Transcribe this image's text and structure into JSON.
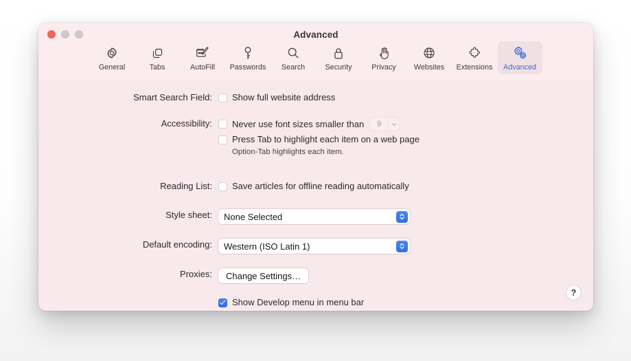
{
  "window": {
    "title": "Advanced",
    "traffic_lights": [
      {
        "name": "close",
        "color": "#f2665a"
      },
      {
        "name": "minimize",
        "color": "#cfc9c9"
      },
      {
        "name": "zoom",
        "color": "#cfc9c9"
      }
    ]
  },
  "toolbar": {
    "selected": "Advanced",
    "accent_color": "#3a6fd8",
    "selected_bg": "#f0dfe3",
    "tabs": [
      {
        "label": "General",
        "icon": "gear-icon"
      },
      {
        "label": "Tabs",
        "icon": "tabs-icon"
      },
      {
        "label": "AutoFill",
        "icon": "autofill-pencil-icon"
      },
      {
        "label": "Passwords",
        "icon": "key-icon"
      },
      {
        "label": "Search",
        "icon": "magnifier-icon"
      },
      {
        "label": "Security",
        "icon": "lock-icon"
      },
      {
        "label": "Privacy",
        "icon": "hand-icon"
      },
      {
        "label": "Websites",
        "icon": "globe-icon"
      },
      {
        "label": "Extensions",
        "icon": "puzzle-piece-icon"
      },
      {
        "label": "Advanced",
        "icon": "double-gear-icon"
      }
    ]
  },
  "settings": {
    "smart_search": {
      "label": "Smart Search Field:",
      "checkbox_label": "Show full website address",
      "checked": false
    },
    "accessibility": {
      "label": "Accessibility:",
      "font_size_label": "Never use font sizes smaller than",
      "font_size_checked": false,
      "font_size_value": "9",
      "font_size_disabled": true,
      "press_tab_label": "Press Tab to highlight each item on a web page",
      "press_tab_checked": false,
      "note": "Option-Tab highlights each item."
    },
    "reading_list": {
      "label": "Reading List:",
      "checkbox_label": "Save articles for offline reading automatically",
      "checked": false
    },
    "style_sheet": {
      "label": "Style sheet:",
      "value": "None Selected"
    },
    "default_encoding": {
      "label": "Default encoding:",
      "value": "Western (ISO Latin 1)"
    },
    "proxies": {
      "label": "Proxies:",
      "button_label": "Change Settings…"
    },
    "develop_menu": {
      "checkbox_label": "Show Develop menu in menu bar",
      "checked": true
    },
    "help_button_label": "?"
  }
}
